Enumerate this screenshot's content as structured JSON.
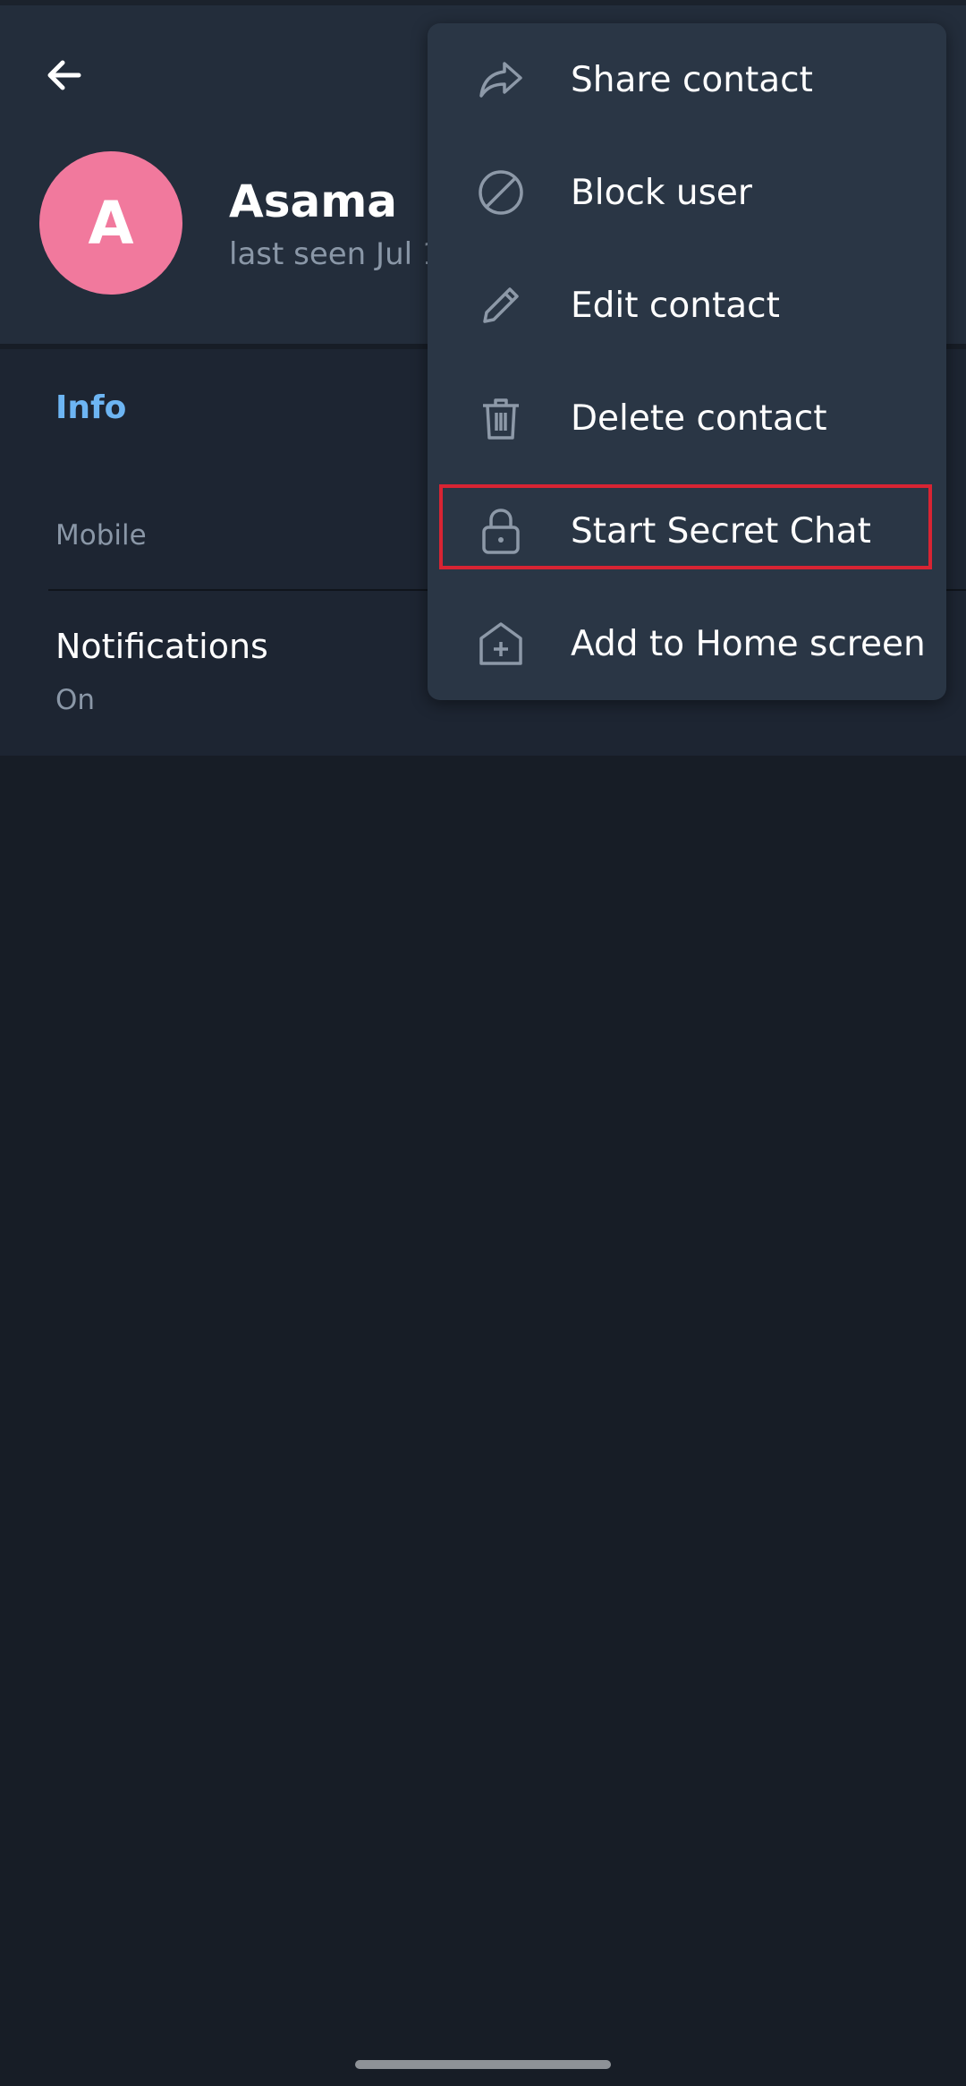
{
  "contact": {
    "initial": "A",
    "name": "Asama",
    "last_seen": "last seen Jul 1",
    "avatar_color": "#f1799d"
  },
  "info": {
    "section_title": "Info",
    "mobile_label": "Mobile",
    "notifications_title": "Notifications",
    "notifications_value": "On"
  },
  "menu": {
    "items": [
      {
        "label": "Share contact",
        "icon": "share-icon"
      },
      {
        "label": "Block user",
        "icon": "block-icon"
      },
      {
        "label": "Edit contact",
        "icon": "pencil-icon"
      },
      {
        "label": "Delete contact",
        "icon": "trash-icon"
      },
      {
        "label": "Start Secret Chat",
        "icon": "lock-icon",
        "highlighted": true
      },
      {
        "label": "Add to Home screen",
        "icon": "add-home-icon"
      }
    ]
  },
  "colors": {
    "background": "#171d26",
    "header": "#232d3b",
    "menu": "#2a3645",
    "accent": "#6db5f3",
    "highlight_border": "#d82433"
  }
}
